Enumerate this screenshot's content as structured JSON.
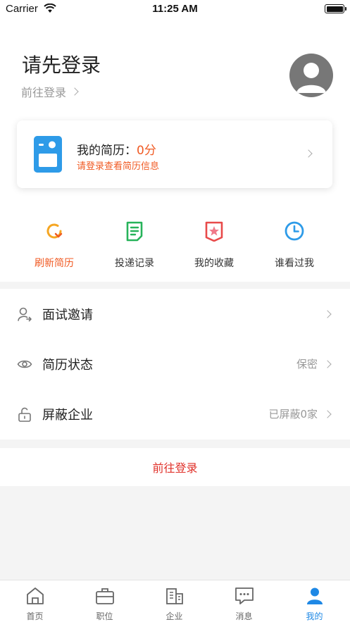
{
  "status_bar": {
    "carrier": "Carrier",
    "time": "11:25 AM"
  },
  "header": {
    "title": "请先登录",
    "login_link": "前往登录"
  },
  "resume_card": {
    "title": "我的简历：",
    "score": "0分",
    "subtitle": "请登录查看简历信息"
  },
  "quick_actions": [
    {
      "label": "刷新简历",
      "icon": "refresh-icon",
      "active": true
    },
    {
      "label": "投递记录",
      "icon": "document-icon",
      "active": false
    },
    {
      "label": "我的收藏",
      "icon": "bookmark-star-icon",
      "active": false
    },
    {
      "label": "谁看过我",
      "icon": "clock-icon",
      "active": false
    }
  ],
  "menu": [
    {
      "label": "面试邀请",
      "value": "",
      "icon": "user-arrow-icon"
    },
    {
      "label": "简历状态",
      "value": "保密",
      "icon": "eye-icon"
    },
    {
      "label": "屏蔽企业",
      "value": "已屏蔽0家",
      "icon": "unlock-icon"
    }
  ],
  "login_button": "前往登录",
  "tabs": [
    {
      "label": "首页",
      "icon": "home-icon",
      "active": false
    },
    {
      "label": "职位",
      "icon": "briefcase-icon",
      "active": false
    },
    {
      "label": "企业",
      "icon": "building-icon",
      "active": false
    },
    {
      "label": "消息",
      "icon": "message-icon",
      "active": false
    },
    {
      "label": "我的",
      "icon": "person-icon",
      "active": true
    }
  ],
  "colors": {
    "accent": "#f05a23",
    "login_red": "#e0312a",
    "tab_active": "#1e88e5",
    "resume_blue": "#2e9be8"
  }
}
